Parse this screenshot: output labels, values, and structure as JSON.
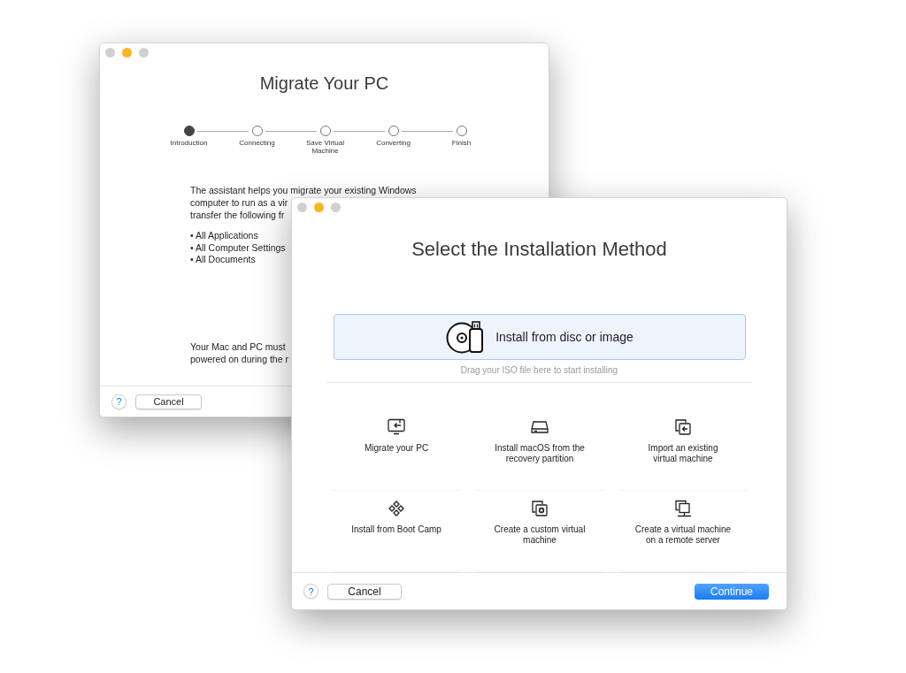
{
  "migrate_window": {
    "title": "Migrate Your PC",
    "steps": [
      {
        "label": "Introduction",
        "selected": true
      },
      {
        "label": "Connecting",
        "selected": false
      },
      {
        "label": "Save Virtual\nMachine",
        "selected": false
      },
      {
        "label": "Converting",
        "selected": false
      },
      {
        "label": "Finish",
        "selected": false
      }
    ],
    "intro_lines": [
      "The assistant helps you migrate your existing Windows",
      "computer to run as a vir",
      "transfer the following fr"
    ],
    "bullets": [
      "• All Applications",
      "• All Computer Settings",
      "• All Documents"
    ],
    "note_lines": [
      "Your Mac and PC must",
      "powered on during the r"
    ],
    "help": "?",
    "cancel": "Cancel"
  },
  "installation_window": {
    "title": "Select the Installation Method",
    "disc_option": {
      "label": "Install from disc or image",
      "selected": true
    },
    "drag_hint": "Drag your ISO file here to start installing",
    "options": [
      {
        "label": "Migrate your PC",
        "selected": false
      },
      {
        "label": "Install macOS from the\nrecovery partition",
        "selected": false
      },
      {
        "label": "Import an existing\nvirtual machine",
        "selected": false
      },
      {
        "label": "Install from Boot Camp",
        "selected": false
      },
      {
        "label": "Create a custom virtual\nmachine",
        "selected": false
      },
      {
        "label": "Create a virtual machine\non a remote server",
        "selected": false
      }
    ],
    "help": "?",
    "cancel": "Cancel",
    "continue": "Continue"
  }
}
